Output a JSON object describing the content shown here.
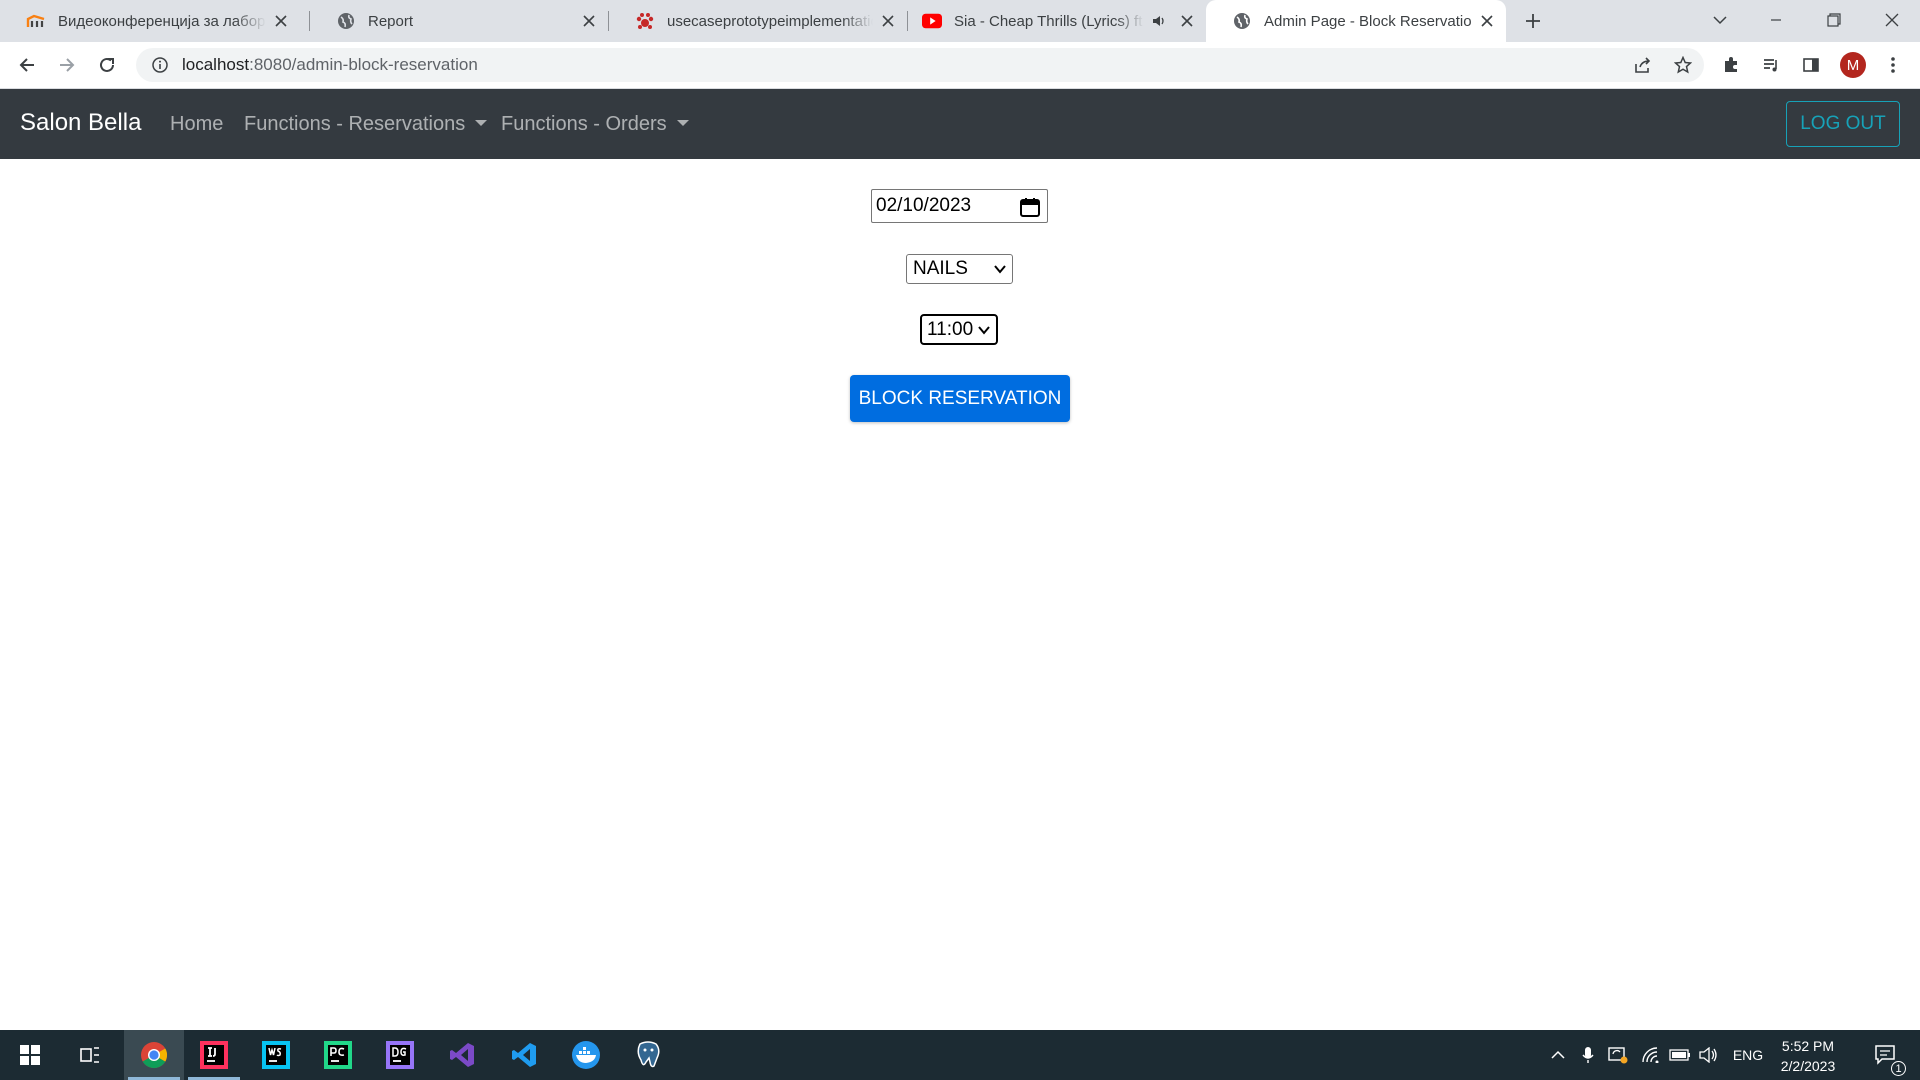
{
  "browser": {
    "tabs": [
      {
        "title": "Видеоконференција за лаборат",
        "icon": "moodle-icon"
      },
      {
        "title": "Report",
        "icon": "globe-icon"
      },
      {
        "title": "usecaseprototypeimplementation",
        "icon": "paw-icon"
      },
      {
        "title": "Sia - Cheap Thrills (Lyrics) ft.",
        "icon": "youtube-icon",
        "audio": true
      },
      {
        "title": "Admin Page - Block Reservation",
        "icon": "globe-icon",
        "active": true
      }
    ],
    "url_host": "localhost",
    "url_rest": ":8080/admin-block-reservation",
    "profile_initial": "M"
  },
  "navbar": {
    "brand": "Salon Bella",
    "home": "Home",
    "reservations": "Functions - Reservations",
    "orders": "Functions - Orders",
    "logout": "LOG OUT"
  },
  "form": {
    "date": "02/10/2023",
    "service": "NAILS",
    "time": "11:00",
    "submit": "BLOCK RESERVATION"
  },
  "taskbar": {
    "language": "ENG",
    "time": "5:52 PM",
    "date": "2/2/2023",
    "notification_count": "1"
  },
  "colors": {
    "navbar_bg": "#343a40",
    "logout_accent": "#17a2b8",
    "button_primary": "#006de0",
    "taskbar_bg": "#1c2b33"
  }
}
